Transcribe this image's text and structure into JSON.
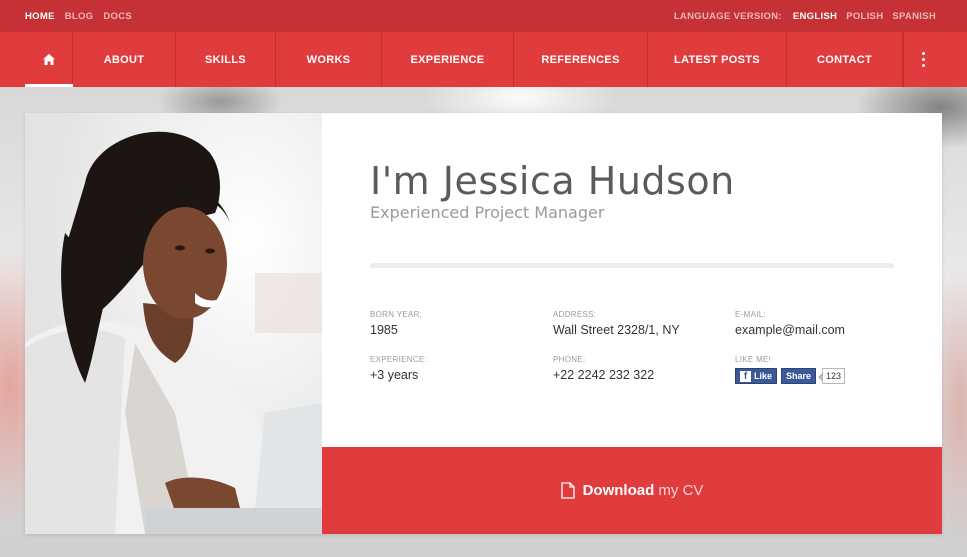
{
  "topbar": {
    "links": [
      "HOME",
      "BLOG",
      "DOCS"
    ],
    "language_label": "LANGUAGE VERSION:",
    "languages": [
      "ENGLISH",
      "POLISH",
      "SPANISH"
    ]
  },
  "nav": {
    "items": [
      "ABOUT",
      "SKILLS",
      "WORKS",
      "EXPERIENCE",
      "REFERENCES",
      "LATEST POSTS",
      "CONTACT"
    ]
  },
  "profile": {
    "name": "I'm Jessica Hudson",
    "role": "Experienced Project Manager",
    "born_label": "BORN YEAR:",
    "born_value": "1985",
    "address_label": "ADDRESS:",
    "address_value": "Wall Street 2328/1, NY",
    "email_label": "E-MAIL:",
    "email_value": "example@mail.com",
    "experience_label": "EXPERIENCE:",
    "experience_value": "+3 years",
    "phone_label": "PHONE:",
    "phone_value": "+22 2242 232 322",
    "like_label": "LIKE ME!",
    "like_button": "Like",
    "share_button": "Share",
    "like_count": "123"
  },
  "download": {
    "bold": "Download",
    "light": "my CV"
  },
  "colors": {
    "topbar": "#c53134",
    "accent": "#e03b3d",
    "facebook": "#3b5998"
  }
}
